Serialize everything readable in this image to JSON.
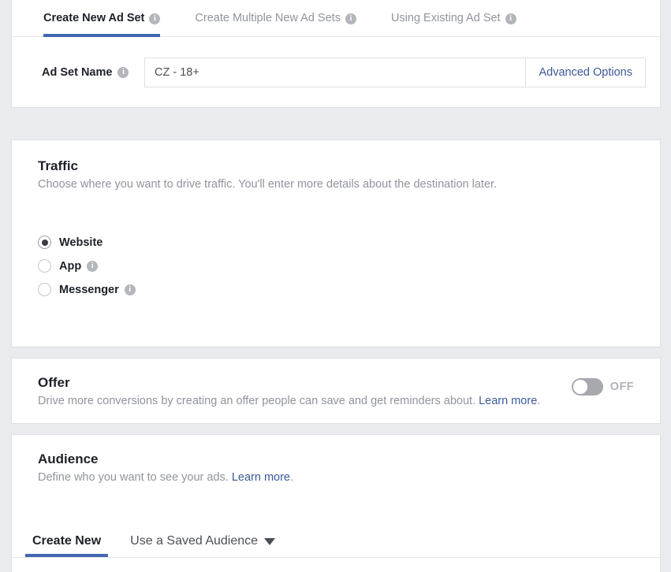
{
  "top": {
    "tabs": [
      {
        "label": "Create New Ad Set",
        "icon": "info-icon",
        "active": true
      },
      {
        "label": "Create Multiple New Ad Sets",
        "icon": "info-icon",
        "active": false
      },
      {
        "label": "Using Existing Ad Set",
        "icon": "info-icon",
        "active": false
      }
    ],
    "adset_name": {
      "label": "Ad Set Name",
      "icon": "info-icon",
      "value": "CZ - 18+",
      "placeholder": "Ad Set Name",
      "advanced_options_label": "Advanced Options"
    }
  },
  "traffic": {
    "title": "Traffic",
    "description": "Choose where you want to drive traffic. You'll enter more details about the destination later.",
    "options": [
      {
        "label": "Website",
        "selected": true,
        "has_info": false
      },
      {
        "label": "App",
        "selected": false,
        "has_info": true
      },
      {
        "label": "Messenger",
        "selected": false,
        "has_info": true
      }
    ]
  },
  "offer": {
    "title": "Offer",
    "description": "Drive more conversions by creating an offer people can save and get reminders about.",
    "learn_more": "Learn more",
    "description_suffix": ".",
    "toggle_state": "OFF"
  },
  "audience": {
    "title": "Audience",
    "description": "Define who you want to see your ads.",
    "learn_more": "Learn more",
    "description_suffix": ".",
    "tabs": [
      {
        "label": "Create New",
        "active": true,
        "has_caret": false
      },
      {
        "label": "Use a Saved Audience",
        "active": false,
        "has_caret": true
      }
    ]
  },
  "colors": {
    "accent_blue": "#4267b2",
    "link_blue": "#3b5998",
    "page_bg": "#e9ebee",
    "card_bg": "#ffffff",
    "muted_text": "#90949c",
    "primary_text": "#1d2129"
  }
}
